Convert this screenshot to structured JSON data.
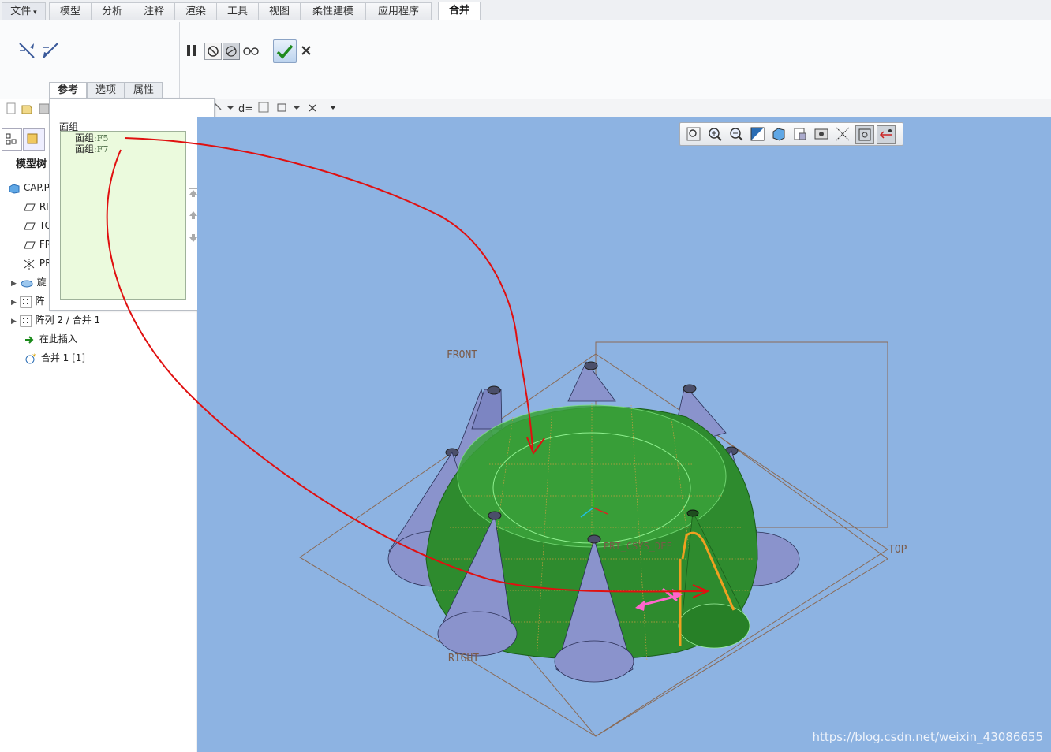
{
  "menu": {
    "file": "文件",
    "tabs": [
      "模型",
      "分析",
      "注释",
      "渲染",
      "工具",
      "视图",
      "柔性建模",
      "应用程序"
    ],
    "active_tab": "合并"
  },
  "dashboard": {
    "tabs": [
      "参考",
      "选项",
      "属性"
    ]
  },
  "references_panel": {
    "section_label": "面组",
    "items": [
      {
        "name": "面组",
        "id": ":F5"
      },
      {
        "name": "面组",
        "id": ":F7"
      }
    ]
  },
  "model_tree": {
    "tab_label": "模型树",
    "rows": [
      {
        "label": "CAP.P",
        "icon": "part-icon"
      },
      {
        "label": "RI",
        "icon": "datum-plane-icon"
      },
      {
        "label": "TC",
        "icon": "datum-plane-icon"
      },
      {
        "label": "FR",
        "icon": "datum-plane-icon"
      },
      {
        "label": "PR",
        "icon": "coordinate-system-icon"
      },
      {
        "label": "旋",
        "icon": "revolve-icon"
      },
      {
        "label": "阵",
        "icon": "pattern-icon"
      },
      {
        "label": "阵列 2 / 合并 1",
        "icon": "pattern-icon"
      },
      {
        "label": "在此插入",
        "icon": "insert-here-arrow-icon"
      },
      {
        "label": "合并 1 [1]",
        "icon": "merge-feature-icon"
      }
    ]
  },
  "viewport": {
    "datum_labels": [
      "FRONT",
      "TOP",
      "RIGHT"
    ],
    "csys_label": "PRT_CSYS_DEF",
    "watermark": "https://blog.csdn.net/weixin_43086655",
    "background_color": "#8db3e2"
  },
  "colors": {
    "merge_quilt": "#2e8b2e",
    "cone_surface": "#8a93cc",
    "annotation_arrow": "#e01010",
    "highlight_edge": "#f0a020",
    "direction_arrow": "#ff66cc"
  }
}
